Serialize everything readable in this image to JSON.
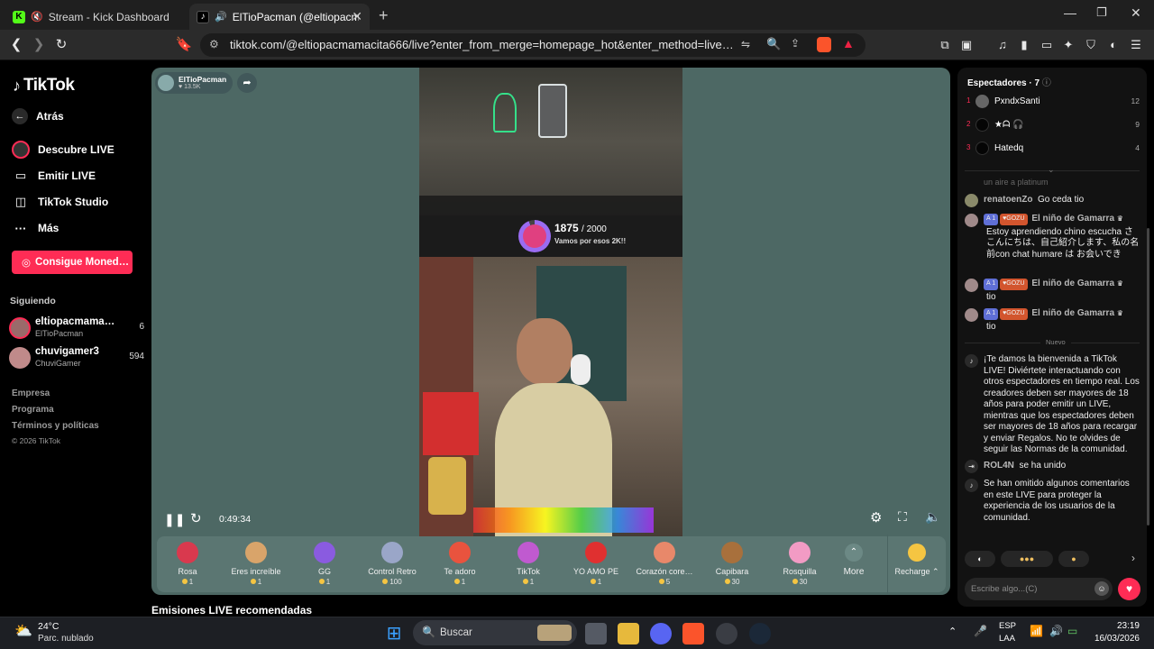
{
  "browser": {
    "tabs": [
      {
        "title": "Stream - Kick Dashboard",
        "favicon": "K",
        "favicon_color": "#53fc18"
      },
      {
        "title": "ElTioPacman (@eltiopacmam…",
        "favicon": "♪",
        "favicon_color": "#000000"
      }
    ],
    "url": "tiktok.com/@eltiopacmamacita666/live?enter_from_merge=homepage_hot&enter_method=live_entrance_…"
  },
  "sidebar": {
    "logo": "TikTok",
    "back": "Atrás",
    "nav": [
      {
        "label": "Descubre LIVE",
        "icon": "live-icon"
      },
      {
        "label": "Emitir LIVE",
        "icon": "camera-icon"
      },
      {
        "label": "TikTok Studio",
        "icon": "studio-icon"
      },
      {
        "label": "Más",
        "icon": "more-icon"
      }
    ],
    "coins_button": "Consigue Moned…",
    "following_title": "Siguiendo",
    "following": [
      {
        "name": "eltiopacmama…",
        "handle": "ElTioPacman",
        "count": "6"
      },
      {
        "name": "chuvigamer3",
        "handle": "ChuviGamer",
        "count": "594"
      }
    ],
    "footer": [
      "Empresa",
      "Programa",
      "Términos y políticas",
      "© 2026 TikTok"
    ]
  },
  "stream": {
    "host_name": "ElTioPacman",
    "host_likes": "13.5K",
    "goal_current": "1875",
    "goal_total": "/ 2000",
    "goal_text": "Vamos por esos 2K!!",
    "elapsed": "0:49:34",
    "recommended_title": "Emisiones LIVE recomendadas"
  },
  "gifts": [
    {
      "name": "Rosa",
      "price": "1",
      "color": "#d9394e"
    },
    {
      "name": "Eres increíble",
      "price": "1",
      "color": "#d9a46a"
    },
    {
      "name": "GG",
      "price": "1",
      "color": "#8a5be0"
    },
    {
      "name": "Control Retro",
      "price": "100",
      "color": "#9aa6c8"
    },
    {
      "name": "Te adoro",
      "price": "1",
      "color": "#e9533e"
    },
    {
      "name": "TikTok",
      "price": "1",
      "color": "#c05ad0"
    },
    {
      "name": "YO AMO PE",
      "price": "1",
      "color": "#e03030"
    },
    {
      "name": "Corazón core…",
      "price": "5",
      "color": "#e8886a"
    },
    {
      "name": "Capibara",
      "price": "30",
      "color": "#a8703c"
    },
    {
      "name": "Rosquilla",
      "price": "30",
      "color": "#f29bc4"
    }
  ],
  "gift_more": "More",
  "recharge": "Recharge",
  "chat": {
    "viewers_title": "Espectadores · 7",
    "viewers": [
      {
        "rank": "1",
        "name": "PxndxSanti",
        "count": "12"
      },
      {
        "rank": "2",
        "name": "★ᗩ 🎧",
        "count": "9"
      },
      {
        "rank": "3",
        "name": "Hatedq",
        "count": "4"
      }
    ],
    "faded": "un aire a platinum",
    "messages": [
      {
        "user": "renatoenZo",
        "text": "Go ceda tio"
      },
      {
        "user": "El niño de Gamarra",
        "level": "1",
        "club": "GOZU",
        "text": "Estoy aprendiendo chino escucha さ こんにちは、自己紹介します、私の名前con chat humare は お会いでき"
      },
      {
        "user": "El niño de Gamarra",
        "level": "1",
        "club": "GOZU",
        "text": "tio"
      },
      {
        "user": "El niño de Gamarra",
        "level": "1",
        "club": "GOZU",
        "text": "tio"
      }
    ],
    "new_label": "Nuevo",
    "welcome": "¡Te damos la bienvenida a TikTok LIVE! Diviértete interactuando con otros espectadores en tiempo real. Los creadores deben ser mayores de 18 años para poder emitir un LIVE, mientras que los espectadores deben ser mayores de 18 años para recargar y enviar Regalos. No te olvides de seguir las Normas de la comunidad.",
    "joined_user": "ROL4N",
    "joined_text": "se ha unido",
    "omitted": "Se han omitido algunos comentarios en este LIVE para proteger la experiencia de los usuarios de la comunidad.",
    "input_placeholder": "Escribe algo...(C)"
  },
  "taskbar": {
    "temp": "24°C",
    "weather": "Parc. nublado",
    "search": "Buscar",
    "lang1": "ESP",
    "lang2": "LAA",
    "time": "23:19",
    "date": "16/03/2026"
  }
}
